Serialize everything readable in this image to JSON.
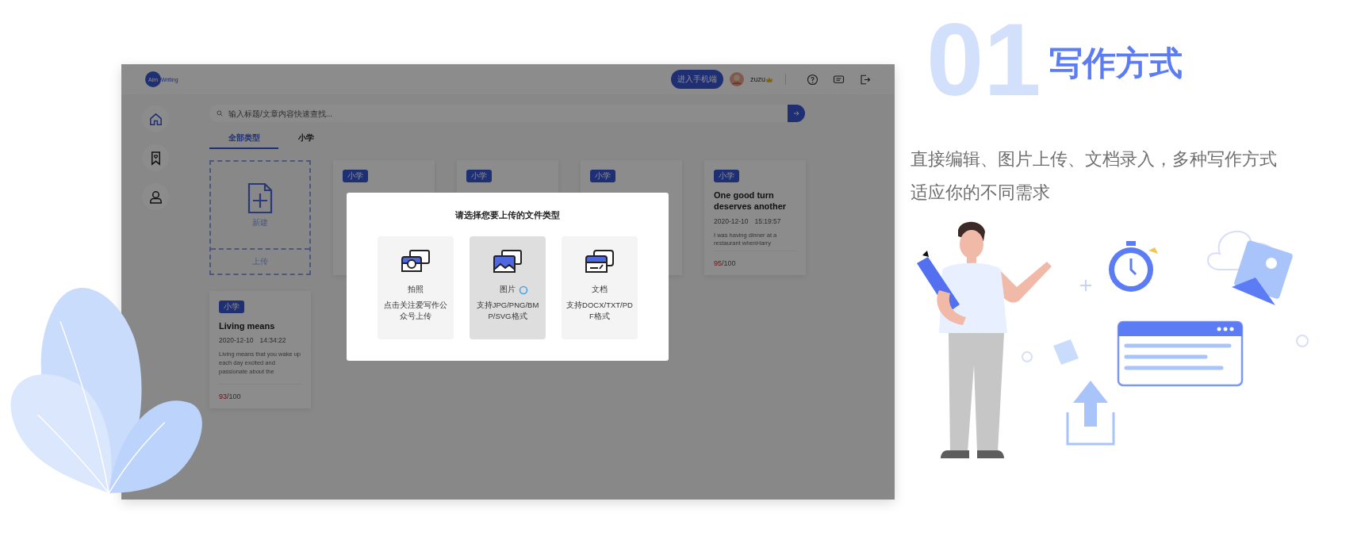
{
  "app": {
    "logo": {
      "badge": "Aim",
      "word": "Writing"
    },
    "mobile_button": "进入手机端",
    "username": "zuzu",
    "search": {
      "placeholder": "输入标题/文章内容快速查找..."
    },
    "tabs": [
      {
        "label": "全部类型",
        "selected": true
      },
      {
        "label": "小学",
        "selected": false
      }
    ],
    "new_card": {
      "new_label": "新建",
      "upload_label": "上传"
    },
    "cards": [
      {
        "tag": "小学"
      },
      {
        "tag": "小学"
      },
      {
        "tag": "小学"
      },
      {
        "tag": "小学",
        "title": "One good turn deserves another",
        "date": "2020-12-10",
        "time": "15:19:57",
        "excerpt": "I was having dinner at a restaurant whenHarry",
        "score": "95",
        "total": "/100"
      },
      {
        "tag": "小学",
        "title": "Living means",
        "date": "2020-12-10",
        "time": "14:34:22",
        "excerpt": "Living means that you wake up each day excited and passionate about the",
        "score": "93",
        "total": "/100"
      }
    ],
    "modal": {
      "title": "请选择您要上传的文件类型",
      "options": [
        {
          "kind": "camera",
          "label": "拍照",
          "description": "点击关注爱写作公众号上传",
          "selected": false,
          "loading": false
        },
        {
          "kind": "image",
          "label": "图片",
          "description": "支持JPG/PNG/BMP/SVG格式",
          "selected": true,
          "loading": true
        },
        {
          "kind": "document",
          "label": "文档",
          "description": "支持DOCX/TXT/PDF格式",
          "selected": false,
          "loading": false
        }
      ]
    }
  },
  "feature": {
    "number": "01",
    "title": "写作方式",
    "description": "直接编辑、图片上传、文档录入，多种写作方式适应你的不同需求"
  }
}
